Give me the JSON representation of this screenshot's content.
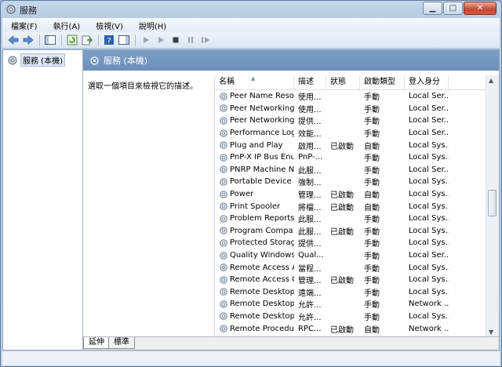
{
  "window": {
    "title": "服務"
  },
  "menu": [
    "檔案(F)",
    "執行(A)",
    "檢視(V)",
    "說明(H)"
  ],
  "tree": {
    "root_label": "服務 (本機)"
  },
  "pane": {
    "header": "服務 (本機)",
    "description": "選取一個項目來檢視它的描述。"
  },
  "columns": [
    "名稱",
    "描述",
    "狀態",
    "啟動類型",
    "登入身分"
  ],
  "rows": [
    {
      "name": "Peer Name Resol...",
      "desc": "使用...",
      "status": "",
      "start": "手動",
      "logon": "Local Ser..."
    },
    {
      "name": "Peer Networking ...",
      "desc": "使用...",
      "status": "",
      "start": "手動",
      "logon": "Local Ser..."
    },
    {
      "name": "Peer Networking ...",
      "desc": "提供...",
      "status": "",
      "start": "手動",
      "logon": "Local Ser..."
    },
    {
      "name": "Performance Log...",
      "desc": "效能...",
      "status": "",
      "start": "手動",
      "logon": "Local Ser..."
    },
    {
      "name": "Plug and Play",
      "desc": "啟用...",
      "status": "已啟動",
      "start": "自動",
      "logon": "Local Sys..."
    },
    {
      "name": "PnP-X IP Bus Enu...",
      "desc": "PnP-...",
      "status": "",
      "start": "手動",
      "logon": "Local Sys..."
    },
    {
      "name": "PNRP Machine N...",
      "desc": "此服...",
      "status": "",
      "start": "手動",
      "logon": "Local Ser..."
    },
    {
      "name": "Portable Device ...",
      "desc": "強制...",
      "status": "",
      "start": "手動",
      "logon": "Local Sys..."
    },
    {
      "name": "Power",
      "desc": "管理...",
      "status": "已啟動",
      "start": "自動",
      "logon": "Local Sys..."
    },
    {
      "name": "Print Spooler",
      "desc": "將檔...",
      "status": "已啟動",
      "start": "自動",
      "logon": "Local Sys..."
    },
    {
      "name": "Problem Reports...",
      "desc": "此服...",
      "status": "",
      "start": "手動",
      "logon": "Local Sys..."
    },
    {
      "name": "Program Compa...",
      "desc": "此服...",
      "status": "已啟動",
      "start": "手動",
      "logon": "Local Sys..."
    },
    {
      "name": "Protected Storage",
      "desc": "提供...",
      "status": "",
      "start": "手動",
      "logon": "Local Sys..."
    },
    {
      "name": "Quality Windows...",
      "desc": "Qual...",
      "status": "",
      "start": "手動",
      "logon": "Local Ser..."
    },
    {
      "name": "Remote Access A...",
      "desc": "當程...",
      "status": "",
      "start": "手動",
      "logon": "Local Sys..."
    },
    {
      "name": "Remote Access C...",
      "desc": "管理...",
      "status": "已啟動",
      "start": "手動",
      "logon": "Local Sys..."
    },
    {
      "name": "Remote Desktop...",
      "desc": "遠端...",
      "status": "",
      "start": "手動",
      "logon": "Local Sys..."
    },
    {
      "name": "Remote Desktop...",
      "desc": "允許...",
      "status": "",
      "start": "手動",
      "logon": "Network ..."
    },
    {
      "name": "Remote Desktop...",
      "desc": "允許...",
      "status": "",
      "start": "手動",
      "logon": "Local Sys..."
    },
    {
      "name": "Remote Procedu...",
      "desc": "RPC...",
      "status": "已啟動",
      "start": "自動",
      "logon": "Network ..."
    }
  ],
  "tabs": [
    "延伸",
    "標準"
  ]
}
